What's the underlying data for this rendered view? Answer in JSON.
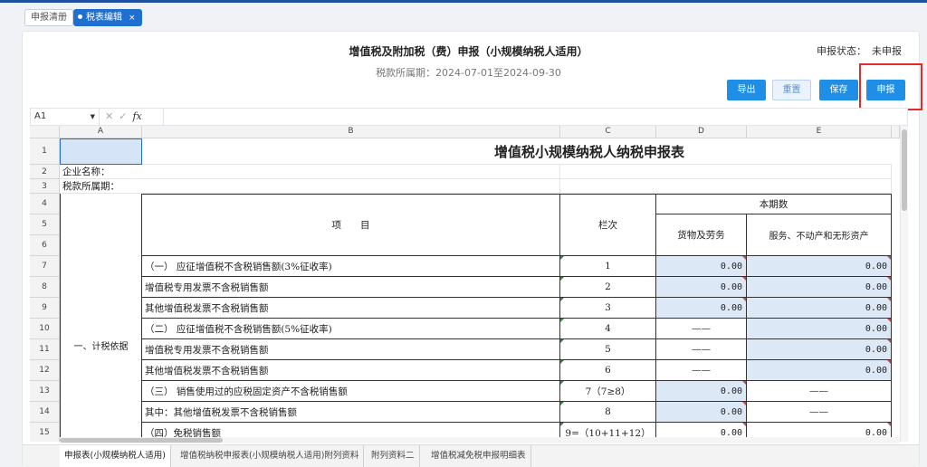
{
  "page_tabs": [
    {
      "label": "申报清册",
      "active": false
    },
    {
      "label": "税表编辑",
      "active": true
    }
  ],
  "header": {
    "title": "增值税及附加税（费）申报（小规模纳税人适用）",
    "period_label": "税款所属期：",
    "period_value": "2024-07-01至2024-09-30",
    "status_label": "申报状态：",
    "status_value": "未申报"
  },
  "toolbar": {
    "export_label": "导出",
    "reset_label": "重置",
    "save_label": "保存",
    "submit_label": "申报"
  },
  "formula_bar": {
    "cell_ref": "A1",
    "fx_label": "fx"
  },
  "columns": [
    "A",
    "B",
    "C",
    "D",
    "E"
  ],
  "rows": [
    "1",
    "2",
    "3",
    "4",
    "5",
    "6",
    "7",
    "8",
    "9",
    "10",
    "11",
    "12",
    "13",
    "14",
    "15"
  ],
  "sheet": {
    "title": "增值税小规模纳税人纳税申报表",
    "company_label": "企业名称：",
    "period_label": "税款所属期：",
    "header_item": "项　　目",
    "header_col": "栏次",
    "header_current": "本期数",
    "header_goods": "货物及劳务",
    "header_services": "服务、不动产和无形资产",
    "section_label": "一、计税依据",
    "lines": [
      {
        "item": "（一） 应征增值税不含税销售额(3%征收率)",
        "col": "1",
        "d": "0.00",
        "e": "0.00"
      },
      {
        "item": " 增值税专用发票不含税销售额",
        "col": "2",
        "d": "0.00",
        "e": "0.00"
      },
      {
        "item": " 其他增值税发票不含税销售额",
        "col": "3",
        "d": "0.00",
        "e": "0.00"
      },
      {
        "item": "（二） 应征增值税不含税销售额(5%征收率)",
        "col": "4",
        "d": "——",
        "e": "0.00"
      },
      {
        "item": "增值税专用发票不含税销售额",
        "col": "5",
        "d": "——",
        "e": "0.00"
      },
      {
        "item": " 其他增值税发票不含税销售额",
        "col": "6",
        "d": "——",
        "e": "0.00"
      },
      {
        "item": "（三） 销售使用过的应税固定资产不含税销售额",
        "col": "7（7≥8）",
        "d": "0.00",
        "e": "——"
      },
      {
        "item": " 其中：其他增值税发票不含税销售额",
        "col": "8",
        "d": "0.00",
        "e": "——"
      },
      {
        "item": "（四）免税销售额",
        "col": "9=（10+11+12）",
        "d": "0.00",
        "e": "0.00"
      }
    ]
  },
  "sheet_tabs": [
    {
      "label": "申报表(小规模纳税人适用)",
      "active": true
    },
    {
      "label": "增值税纳税申报表(小规模纳税人适用)附列资料",
      "active": false
    },
    {
      "label": "附列资料二",
      "active": false
    },
    {
      "label": "增值税减免税申报明细表",
      "active": false
    }
  ],
  "colors": {
    "accent": "#1f8ee6",
    "input_cell": "#dce8f5",
    "highlight": "#e52a2a"
  }
}
